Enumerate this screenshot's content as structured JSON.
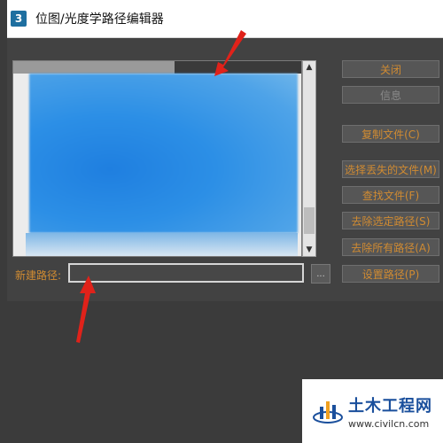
{
  "window": {
    "title": "位图/光度学路径编辑器",
    "icon_glyph": "3"
  },
  "newpath": {
    "label": "新建路径:",
    "browse_label": "..."
  },
  "buttons": [
    {
      "label": "关闭",
      "enabled": true
    },
    {
      "label": "信息",
      "enabled": false
    },
    {
      "label": "复制文件(C)",
      "enabled": true
    },
    {
      "label": "选择丢失的文件(M)",
      "enabled": true
    },
    {
      "label": "查找文件(F)",
      "enabled": true
    },
    {
      "label": "去除选定路径(S)",
      "enabled": true
    },
    {
      "label": "去除所有路径(A)",
      "enabled": true
    },
    {
      "label": "设置路径(P)",
      "enabled": true
    }
  ],
  "watermark": {
    "name": "土木工程网",
    "url": "www.civilcn.com"
  },
  "colors": {
    "accent_text": "#d08b32",
    "arrow": "#e0221a",
    "background": "#3b3b3b"
  }
}
